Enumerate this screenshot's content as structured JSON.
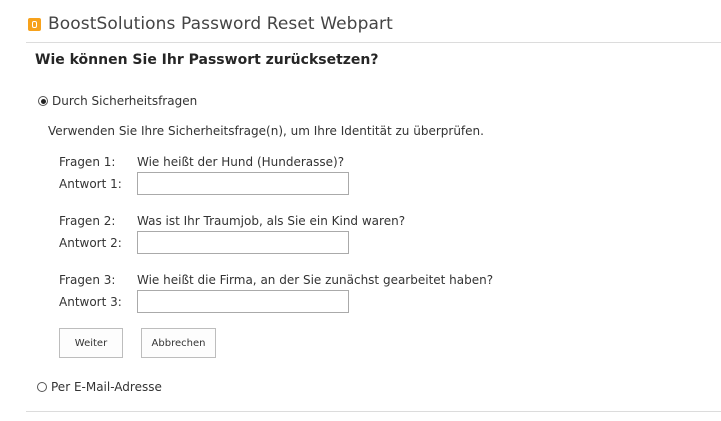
{
  "header": {
    "title": "BoostSolutions Password Reset Webpart",
    "logo_icon": "boostsolutions-logo-icon",
    "logo_color": "#f7a21c"
  },
  "section": {
    "title": "Wie können Sie Ihr Passwort zurücksetzen?"
  },
  "options": {
    "security_questions": {
      "label": "Durch Sicherheitsfragen",
      "selected": true
    },
    "email": {
      "label": "Per E-Mail-Adresse",
      "selected": false
    }
  },
  "instruction": "Verwenden Sie Ihre Sicherheitsfrage(n), um Ihre Identität zu überprüfen.",
  "questions": [
    {
      "question_label": "Fragen 1:",
      "question_text": "Wie heißt der Hund (Hunderasse)?",
      "answer_label": "Antwort 1:",
      "answer_value": ""
    },
    {
      "question_label": "Fragen 2:",
      "question_text": "Was ist Ihr Traumjob, als Sie ein Kind waren?",
      "answer_label": "Antwort 2:",
      "answer_value": ""
    },
    {
      "question_label": "Fragen 3:",
      "question_text": "Wie heißt die Firma, an der Sie zunächst gearbeitet haben?",
      "answer_label": "Antwort 3:",
      "answer_value": ""
    }
  ],
  "buttons": {
    "next_label": "Weiter",
    "cancel_label": "Abbrechen"
  }
}
